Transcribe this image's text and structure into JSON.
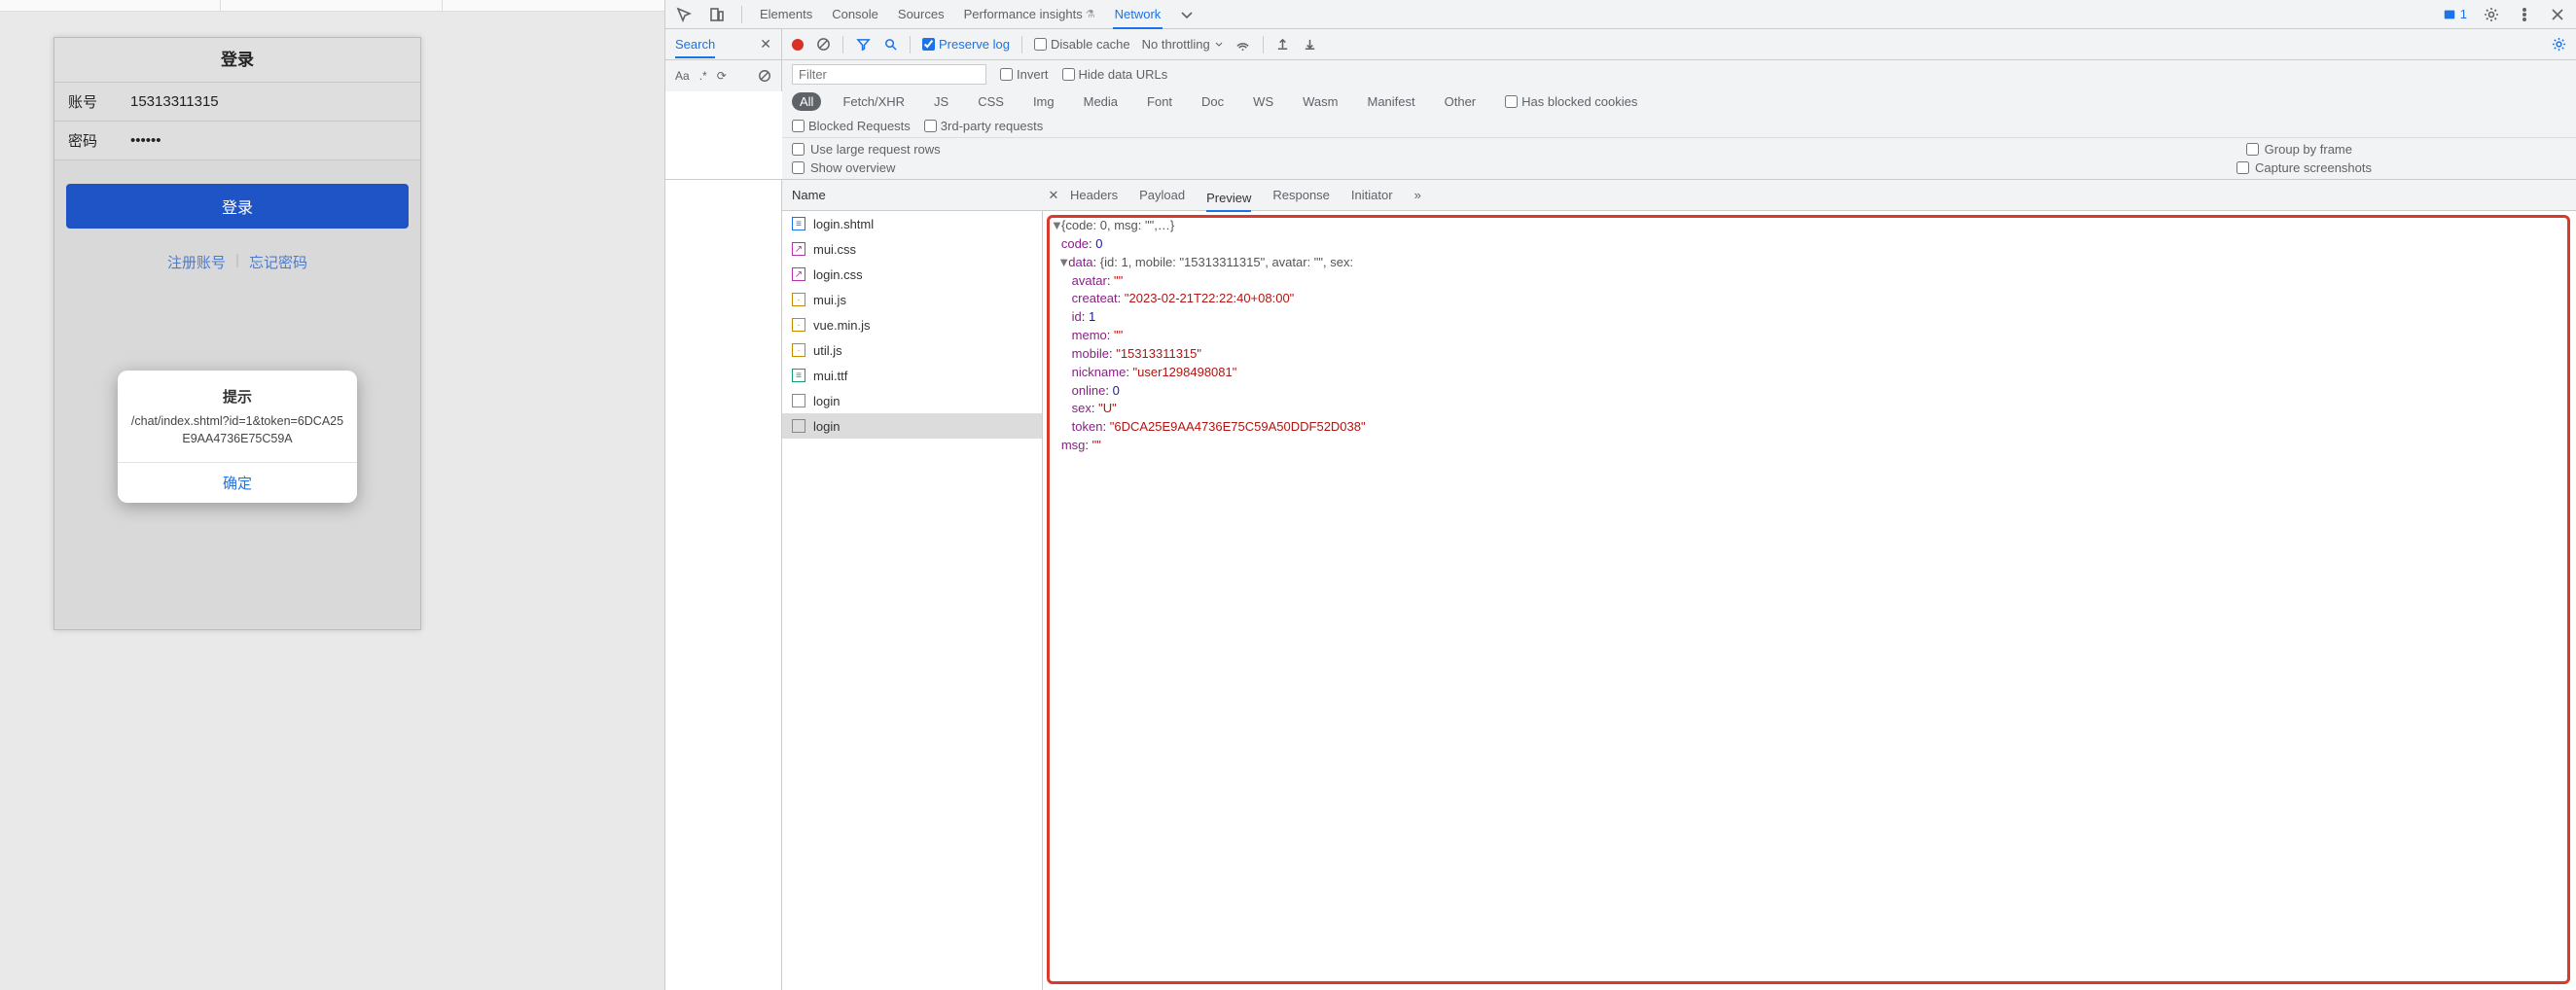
{
  "phone": {
    "title": "登录",
    "account_label": "账号",
    "account_value": "15313311315",
    "password_label": "密码",
    "password_value": "••••••",
    "login_btn": "登录",
    "link_register": "注册账号",
    "link_forgot": "忘记密码",
    "modal_title": "提示",
    "modal_body": "/chat/index.shtml?id=1&token=6DCA25E9AA4736E75C59A",
    "modal_ok": "确定"
  },
  "devtools": {
    "tabs": [
      "Elements",
      "Console",
      "Sources",
      "Performance insights",
      "Network"
    ],
    "active_tab": "Network",
    "issues_count": "1",
    "search_label": "Search",
    "search_opts": {
      "aa": "Aa",
      "re": ".*"
    },
    "toolbar": {
      "preserve_log": "Preserve log",
      "disable_cache": "Disable cache",
      "throttle": "No throttling"
    },
    "filter_placeholder": "Filter",
    "filter_invert": "Invert",
    "filter_hide_data": "Hide data URLs",
    "chips": [
      "All",
      "Fetch/XHR",
      "JS",
      "CSS",
      "Img",
      "Media",
      "Font",
      "Doc",
      "WS",
      "Wasm",
      "Manifest",
      "Other"
    ],
    "chip_blocked_cookies": "Has blocked cookies",
    "chip_blocked_req": "Blocked Requests",
    "chip_thirdparty": "3rd-party requests",
    "opt_large_rows": "Use large request rows",
    "opt_group_frame": "Group by frame",
    "opt_show_overview": "Show overview",
    "opt_screenshots": "Capture screenshots",
    "name_col": "Name",
    "detail_tabs": [
      "Headers",
      "Payload",
      "Preview",
      "Response",
      "Initiator"
    ],
    "active_detail_tab": "Preview",
    "requests": [
      {
        "name": "login.shtml",
        "type": "doc"
      },
      {
        "name": "mui.css",
        "type": "css"
      },
      {
        "name": "login.css",
        "type": "css"
      },
      {
        "name": "mui.js",
        "type": "js"
      },
      {
        "name": "vue.min.js",
        "type": "js"
      },
      {
        "name": "util.js",
        "type": "js"
      },
      {
        "name": "mui.ttf",
        "type": "ttf"
      },
      {
        "name": "login",
        "type": "xhr"
      },
      {
        "name": "login",
        "type": "xhr",
        "selected": true
      }
    ],
    "preview": {
      "root_summary": "{code: 0, msg: \"\",…}",
      "code": 0,
      "data_summary": "{id: 1, mobile: \"15313311315\", avatar: \"\", sex:",
      "data": {
        "avatar": "\"\"",
        "createat": "\"2023-02-21T22:22:40+08:00\"",
        "id": 1,
        "memo": "\"\"",
        "mobile": "\"15313311315\"",
        "nickname": "\"user1298498081\"",
        "online": 0,
        "sex": "\"U\"",
        "token": "\"6DCA25E9AA4736E75C59A50DDF52D038\""
      },
      "msg": "\"\""
    }
  }
}
